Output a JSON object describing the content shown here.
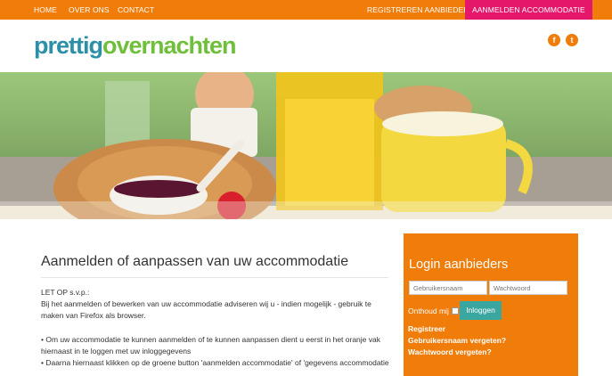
{
  "nav": {
    "home": "HOME",
    "over_ons": "OVER ONS",
    "contact": "CONTACT",
    "registreren": "REGISTREREN AANBIEDERS",
    "aanmelden": "AANMELDEN ACCOMMODATIE"
  },
  "logo": {
    "part1": "prettig",
    "part2": "overnachten"
  },
  "social": {
    "facebook": "f",
    "twitter": "t"
  },
  "content": {
    "title": "Aanmelden of aanpassen van uw accommodatie",
    "line1": "LET OP s.v.p.:",
    "line2": "Bij het aanmelden of bewerken van uw accommodatie adviseren wij u - indien mogelijk - gebruik te",
    "line3": "maken van Firefox als browser.",
    "line4": "• Om uw accommodatie te kunnen aanmelden of te kunnen aanpassen dient u eerst in het oranje vak",
    "line5": "hiernaast in te loggen met uw inloggegevens",
    "line6": "• Daarna hiernaast klikken op de groene button 'aanmelden accommodatie' of 'gegevens accommodatie"
  },
  "login": {
    "title": "Login aanbieders",
    "username_placeholder": "Gebruikersnaam",
    "password_placeholder": "Wachtwoord",
    "remember": "Onthoud mij",
    "button": "Inloggen",
    "register": "Registreer",
    "forgot_user": "Gebruikersnaam vergeten?",
    "forgot_pass": "Wachtwoord vergeten?"
  }
}
